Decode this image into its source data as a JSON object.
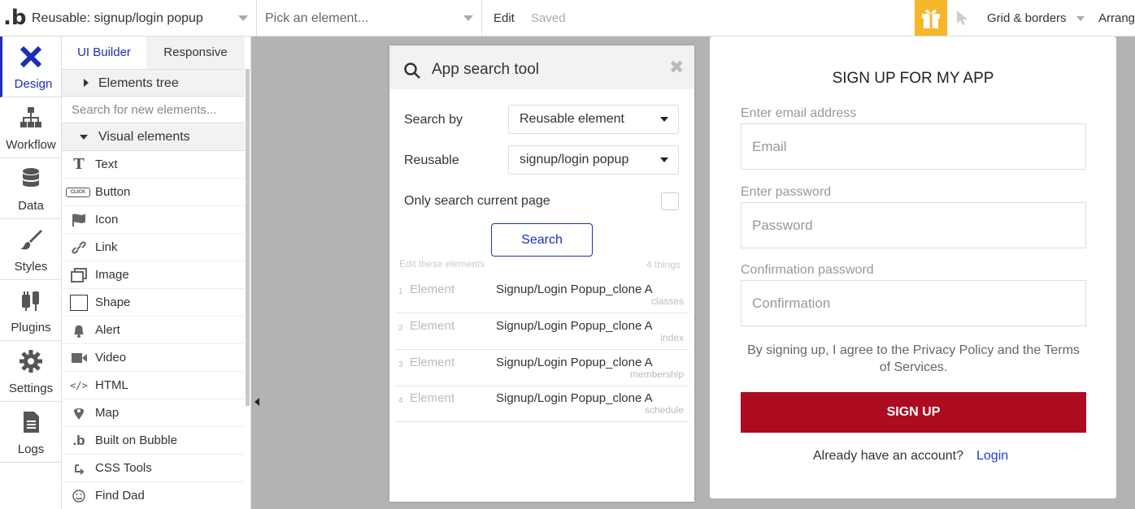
{
  "topbar": {
    "logo": ".b",
    "page_select": "Reusable: signup/login popup",
    "element_select": "Pick an element...",
    "edit": "Edit",
    "saved": "Saved",
    "grid": "Grid & borders",
    "arrange": "Arrange"
  },
  "nav": {
    "items": [
      {
        "label": "Design",
        "icon": "design-icon"
      },
      {
        "label": "Workflow",
        "icon": "workflow-icon"
      },
      {
        "label": "Data",
        "icon": "data-icon"
      },
      {
        "label": "Styles",
        "icon": "styles-icon"
      },
      {
        "label": "Plugins",
        "icon": "plugins-icon"
      },
      {
        "label": "Settings",
        "icon": "settings-icon"
      },
      {
        "label": "Logs",
        "icon": "logs-icon"
      }
    ]
  },
  "panel": {
    "tab_ui": "UI Builder",
    "tab_responsive": "Responsive",
    "elements_tree": "Elements tree",
    "search_placeholder": "Search for new elements...",
    "visual_elements": "Visual elements",
    "elements": [
      {
        "label": "Text",
        "icon": "T"
      },
      {
        "label": "Button",
        "icon": "CLICK"
      },
      {
        "label": "Icon",
        "icon": "flag"
      },
      {
        "label": "Link",
        "icon": "link"
      },
      {
        "label": "Image",
        "icon": "image"
      },
      {
        "label": "Shape",
        "icon": "shape"
      },
      {
        "label": "Alert",
        "icon": "bell"
      },
      {
        "label": "Video",
        "icon": "video"
      },
      {
        "label": "HTML",
        "icon": "</>"
      },
      {
        "label": "Map",
        "icon": "pin"
      },
      {
        "label": "Built on Bubble",
        "icon": "b"
      },
      {
        "label": "CSS Tools",
        "icon": "css"
      },
      {
        "label": "Find Dad",
        "icon": "smile"
      }
    ]
  },
  "search_tool": {
    "title": "App search tool",
    "search_by_label": "Search by",
    "search_by_value": "Reusable element",
    "reusable_label": "Reusable",
    "reusable_value": "signup/login popup",
    "only_current_label": "Only search current page",
    "search_button": "Search",
    "edit_header": "Edit these elements",
    "count": "4 things",
    "results": [
      {
        "num": "1",
        "type": "Element",
        "name": "Signup/Login Popup_clone A",
        "page": "classes"
      },
      {
        "num": "2",
        "type": "Element",
        "name": "Signup/Login Popup_clone A",
        "page": "index"
      },
      {
        "num": "3",
        "type": "Element",
        "name": "Signup/Login Popup_clone A",
        "page": "membership"
      },
      {
        "num": "4",
        "type": "Element",
        "name": "Signup/Login Popup_clone A",
        "page": "schedule"
      }
    ]
  },
  "signup": {
    "title": "SIGN UP FOR MY APP",
    "email_label": "Enter email address",
    "email_placeholder": "Email",
    "password_label": "Enter password",
    "password_placeholder": "Password",
    "confirm_label": "Confirmation password",
    "confirm_placeholder": "Confirmation",
    "terms": "By signing up, I agree to the Privacy Policy and the Terms of Services.",
    "button": "SIGN UP",
    "already": "Already have an account?",
    "login": "Login"
  },
  "colors": {
    "accent": "#1a2fb5",
    "signup_button": "#ad0b20",
    "gift": "#f5b72a"
  }
}
